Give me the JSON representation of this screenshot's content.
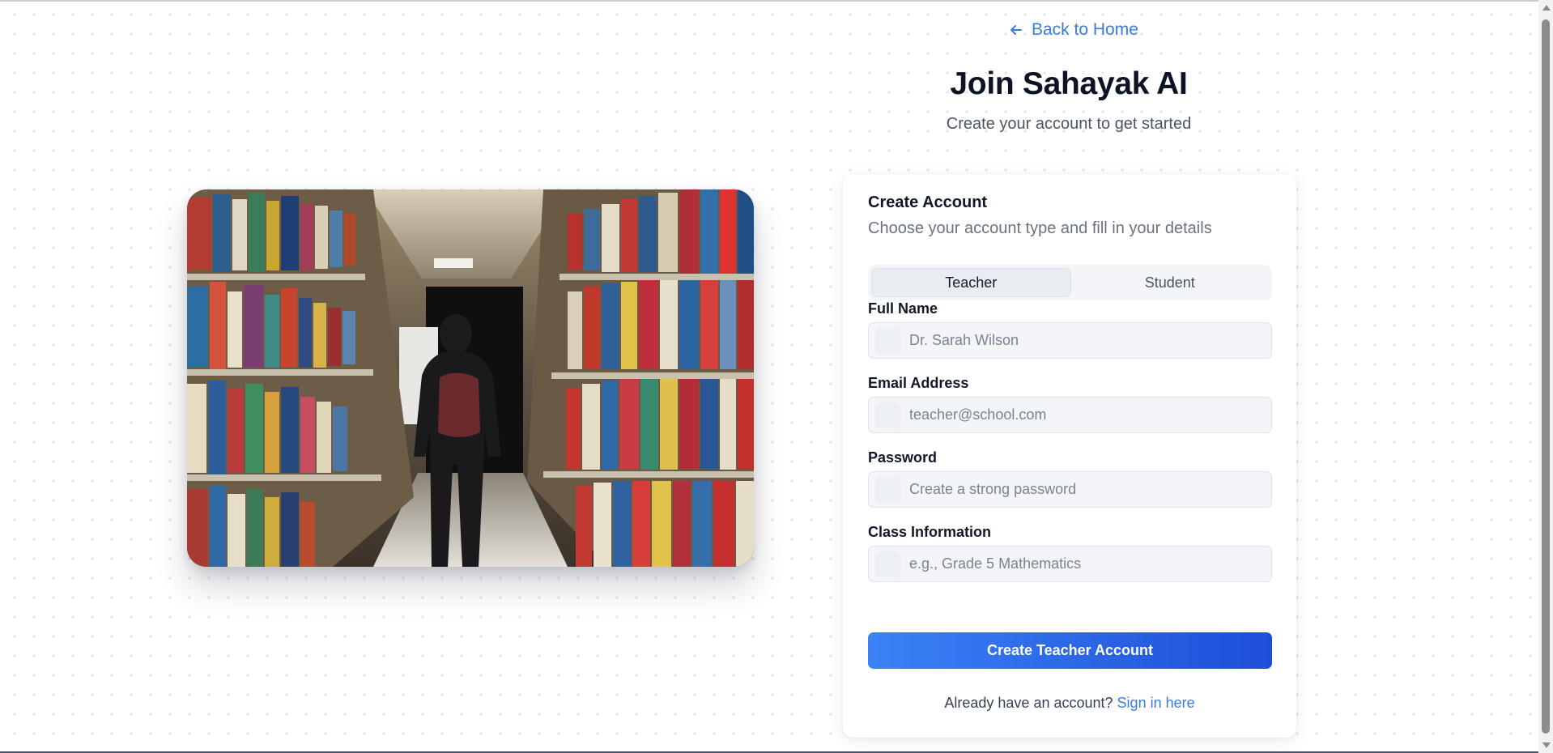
{
  "header": {
    "back_label": "Back to Home",
    "title": "Join Sahayak AI",
    "subtitle": "Create your account to get started"
  },
  "hero": {
    "icon": "library-photo"
  },
  "form": {
    "title": "Create Account",
    "description": "Choose your account type and fill in your details",
    "tabs": [
      {
        "label": "Teacher",
        "active": true
      },
      {
        "label": "Student",
        "active": false
      }
    ],
    "fields": [
      {
        "label": "Full Name",
        "placeholder": "Dr. Sarah Wilson",
        "value": ""
      },
      {
        "label": "Email Address",
        "placeholder": "teacher@school.com",
        "value": ""
      },
      {
        "label": "Password",
        "placeholder": "Create a strong password",
        "value": ""
      },
      {
        "label": "Class Information",
        "placeholder": "e.g., Grade 5 Mathematics",
        "value": ""
      }
    ],
    "submit_label": "Create Teacher Account",
    "signin_prompt": "Already have an account?",
    "signin_link": "Sign in here"
  },
  "colors": {
    "accent": "#3b7be0",
    "button_start": "#3b82f6",
    "button_end": "#1d4ed8"
  }
}
